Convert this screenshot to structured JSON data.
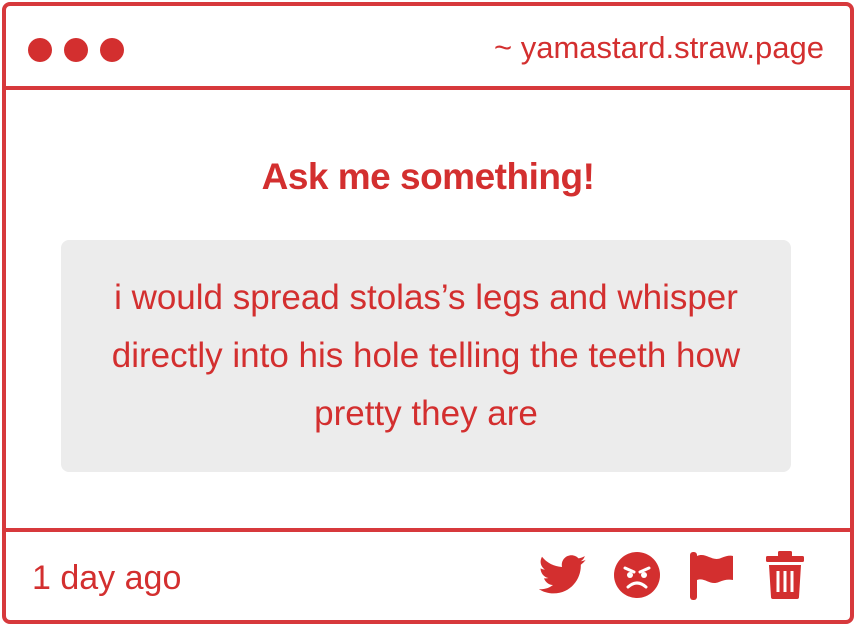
{
  "window": {
    "url": "~ yamastard.straw.page"
  },
  "content": {
    "heading": "Ask me something!",
    "question": "i would spread stolas’s legs and whisper directly into his hole telling the teeth how pretty they are"
  },
  "footer": {
    "timestamp": "1 day ago",
    "actions": [
      {
        "name": "twitter-share",
        "icon": "twitter-icon"
      },
      {
        "name": "react",
        "icon": "angry-face-icon"
      },
      {
        "name": "report",
        "icon": "flag-icon"
      },
      {
        "name": "delete",
        "icon": "trash-icon"
      }
    ]
  },
  "colors": {
    "accent": "#d32f2f",
    "border": "#d7393c",
    "question_bg": "#ececec"
  }
}
